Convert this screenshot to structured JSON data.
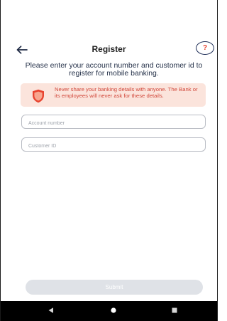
{
  "header": {
    "title": "Register",
    "back_icon": "arrow-left-icon",
    "help_icon": "question-icon",
    "help_symbol": "?"
  },
  "subtitle": "Please enter your account number and customer id to register for mobile banking.",
  "alert": {
    "icon": "shield-icon",
    "text": "Never share your banking details with anyone. The Bank or its employees will never ask for these details."
  },
  "form": {
    "account_number": {
      "placeholder": "Account number",
      "value": ""
    },
    "customer_id": {
      "placeholder": "Customer ID",
      "value": ""
    },
    "submit_label": "Submit"
  },
  "navbar": {
    "back_icon": "triangle-back-icon",
    "home_icon": "circle-home-icon",
    "recents_icon": "square-recents-icon"
  },
  "colors": {
    "accent": "#e8432f",
    "alert_bg": "#fbe4dc",
    "alert_text": "#d1473a",
    "button_disabled": "#dfe2e7",
    "help_border": "#1b2b55"
  }
}
